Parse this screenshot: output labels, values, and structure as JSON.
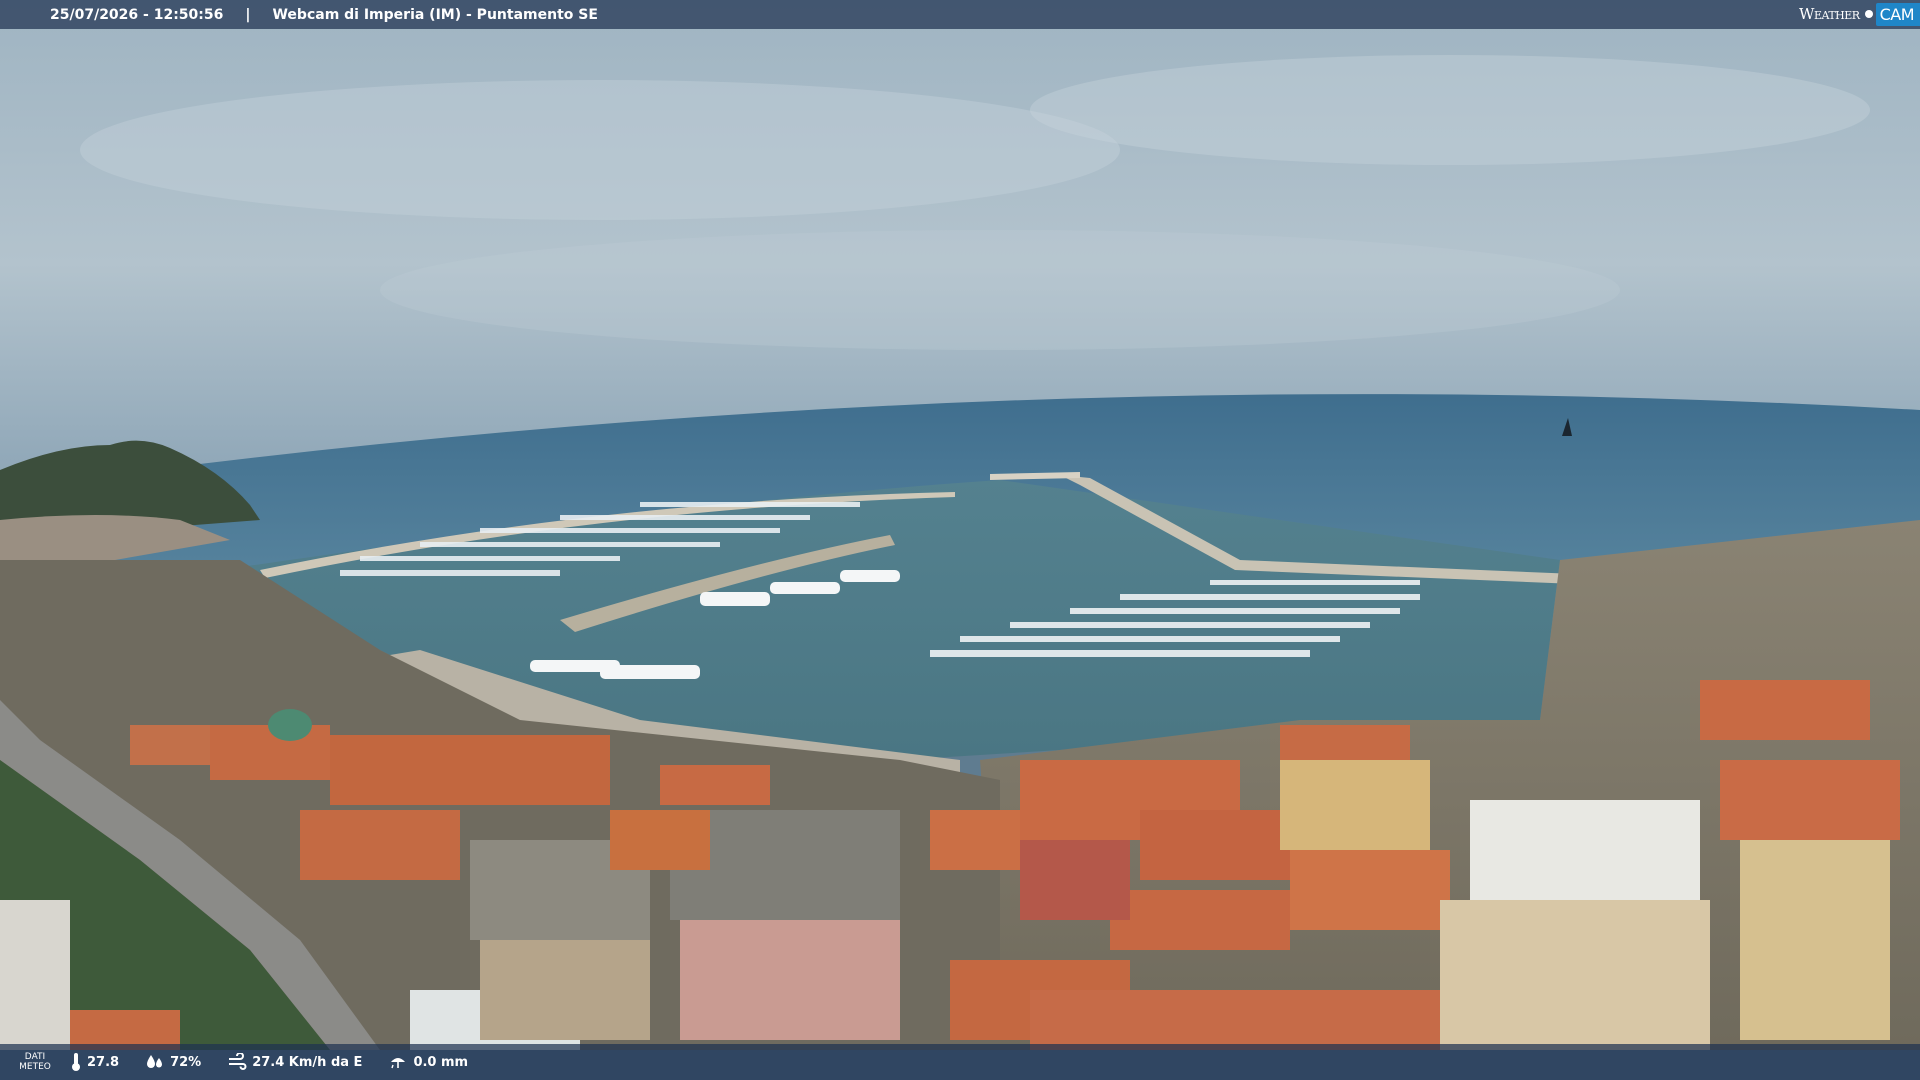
{
  "overlay": {
    "timestamp": "25/07/2026 - 12:50:56",
    "separator": "|",
    "title": "Webcam di Imperia (IM) - Puntamento SE",
    "brand_word": "Weather",
    "brand_cam": "CAM"
  },
  "weather": {
    "label_line1": "DATI",
    "label_line2": "METEO",
    "temperature": "27.8",
    "humidity": "72%",
    "wind": "27.4 Km/h da E",
    "rain": "0.0 mm"
  },
  "icons": {
    "temperature": "thermometer-icon",
    "humidity": "humidity-drops-icon",
    "wind": "wind-icon",
    "rain": "rain-icon"
  },
  "colors": {
    "bar": "#1e3250",
    "brand_blue": "#1f86c8"
  }
}
